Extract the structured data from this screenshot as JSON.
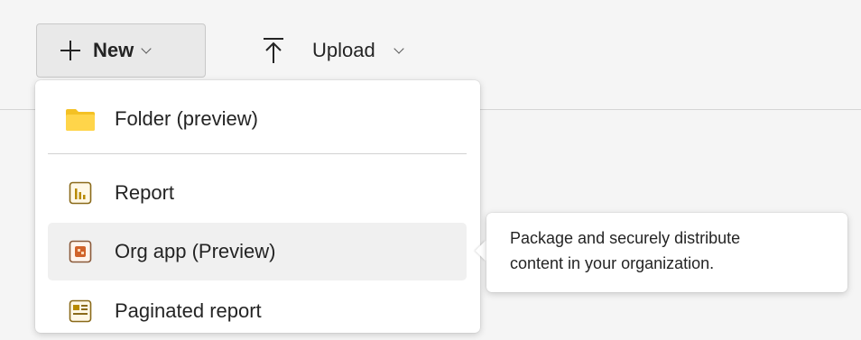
{
  "toolbar": {
    "new_label": "New",
    "upload_label": "Upload"
  },
  "menu": {
    "items": [
      {
        "label": "Folder (preview)",
        "icon": "folder-icon"
      },
      {
        "label": "Report",
        "icon": "report-icon"
      },
      {
        "label": "Org app (Preview)",
        "icon": "org-app-icon"
      },
      {
        "label": "Paginated report",
        "icon": "paginated-report-icon"
      }
    ]
  },
  "tooltip": {
    "line1": "Package and securely distribute",
    "line2": "content in your organization."
  },
  "colors": {
    "folder": "#f4c124",
    "report_accent": "#b88a00",
    "org_app_accent": "#d0632a",
    "hover_bg": "#f0f0f0"
  }
}
